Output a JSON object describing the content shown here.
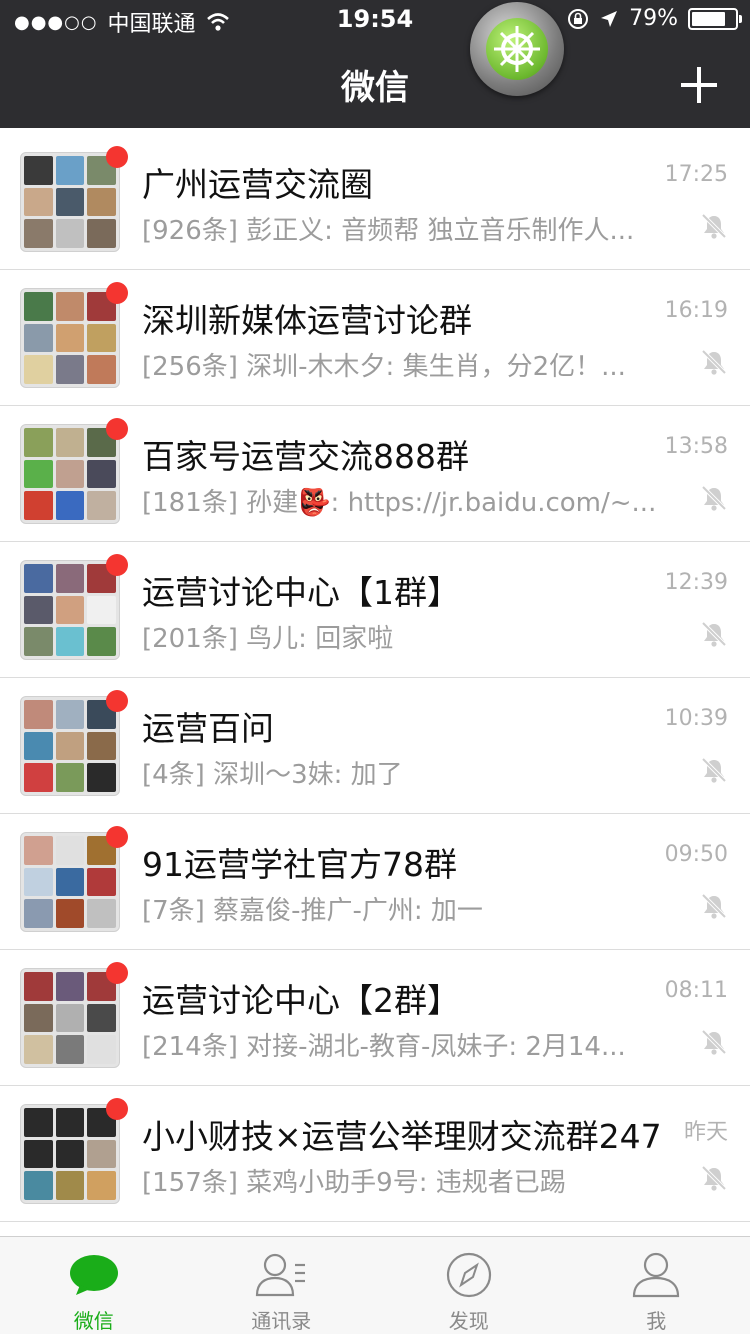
{
  "status_bar": {
    "signal": "●●●○○",
    "carrier": "中国联通",
    "time": "19:54",
    "battery": "79%",
    "battery_level": 0.79
  },
  "nav": {
    "title": "微信"
  },
  "chats": [
    {
      "name": "广州运营交流圈",
      "time": "17:25",
      "preview": "[926条] 彭正义: 音频帮 独立音乐制作人...",
      "unread": true,
      "muted": true,
      "avatar_colors": [
        "#3a3a3a",
        "#6aa0c8",
        "#7a8a6a",
        "#c9a88a",
        "#4a5a6a",
        "#b08a60",
        "#8a7a6a",
        "#c0c0c0",
        "#7a6a5a"
      ]
    },
    {
      "name": "深圳新媒体运营讨论群",
      "time": "16:19",
      "preview": "[256条] 深圳-木木夕: 集生肖，分2亿！...",
      "unread": true,
      "muted": true,
      "avatar_colors": [
        "#4a7a4a",
        "#c08a6a",
        "#a03a3a",
        "#8a9aaa",
        "#d0a070",
        "#c0a060",
        "#e0d0a0",
        "#7a7a8a",
        "#c07a5a"
      ]
    },
    {
      "name": "百家号运营交流888群",
      "time": "13:58",
      "preview": "[181条] 孙建👺: https://jr.baidu.com/~...",
      "unread": true,
      "muted": true,
      "avatar_colors": [
        "#8aa05a",
        "#c0b090",
        "#5a6a4a",
        "#5ab04a",
        "#c0a090",
        "#4a4a5a",
        "#d04030",
        "#3a6ac0",
        "#c0b0a0"
      ]
    },
    {
      "name": "运营讨论中心【1群】",
      "time": "12:39",
      "preview": "[201条] 鸟儿: 回家啦",
      "unread": true,
      "muted": true,
      "avatar_colors": [
        "#4a6aa0",
        "#8a6a7a",
        "#a03a3a",
        "#5a5a6a",
        "#d0a080",
        "#f0f0f0",
        "#7a8a6a",
        "#6ac0d0",
        "#5a8a4a"
      ]
    },
    {
      "name": "运营百问",
      "time": "10:39",
      "preview": "[4条] 深圳～3妹: 加了",
      "unread": true,
      "muted": true,
      "avatar_colors": [
        "#c08a7a",
        "#a0b0c0",
        "#3a4a5a",
        "#4a8ab0",
        "#c0a080",
        "#8a6a4a",
        "#d04040",
        "#7a9a5a",
        "#2a2a2a"
      ]
    },
    {
      "name": "91运营学社官方78群",
      "time": "09:50",
      "preview": "[7条] 蔡嘉俊-推广-广州: 加一",
      "unread": true,
      "muted": true,
      "avatar_colors": [
        "#d0a090",
        "#e0e0e0",
        "#a07030",
        "#c0d0e0",
        "#3a6aa0",
        "#b03a3a",
        "#8a9ab0",
        "#a04a2a",
        "#c0c0c0"
      ]
    },
    {
      "name": "运营讨论中心【2群】",
      "time": "08:11",
      "preview": "[214条] 对接-湖北-教育-凤妹子: 2月14...",
      "unread": true,
      "muted": true,
      "avatar_colors": [
        "#a03a3a",
        "#6a5a7a",
        "#a03a3a",
        "#7a6a5a",
        "#b0b0b0",
        "#4a4a4a",
        "#d0c0a0",
        "#7a7a7a",
        "#e0e0e0"
      ]
    },
    {
      "name": "小小财技×运营公举理财交流群247",
      "time": "昨天",
      "preview": "[157条] 菜鸡小助手9号: 违规者已踢",
      "unread": true,
      "muted": true,
      "avatar_colors": [
        "#2a2a2a",
        "#2a2a2a",
        "#2a2a2a",
        "#2a2a2a",
        "#2a2a2a",
        "#b0a090",
        "#4a8aa0",
        "#a08a4a",
        "#d0a060"
      ]
    }
  ],
  "tabs": [
    {
      "label": "微信",
      "icon": "chat-bubble-icon",
      "active": true
    },
    {
      "label": "通讯录",
      "icon": "contacts-icon",
      "active": false
    },
    {
      "label": "发现",
      "icon": "compass-icon",
      "active": false
    },
    {
      "label": "我",
      "icon": "person-icon",
      "active": false
    }
  ],
  "colors": {
    "header_bg": "#2d2d30",
    "unread_dot": "#f43530",
    "active_tab": "#1aad19",
    "inactive_tab": "#8a8a8a"
  }
}
